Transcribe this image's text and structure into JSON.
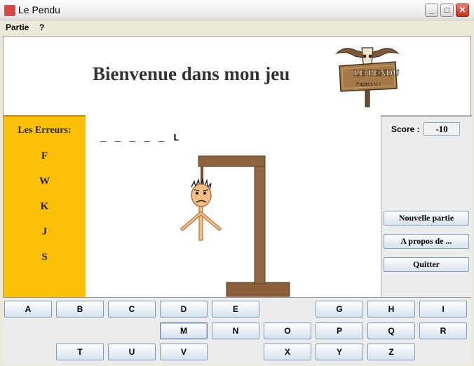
{
  "window": {
    "title": "Le Pendu"
  },
  "menu": {
    "items": [
      "Partie",
      "?"
    ]
  },
  "header": {
    "welcome": "Bienvenue dans mon jeu",
    "logo_text_main": "LE PENDU",
    "logo_text_sub": "Papiers U !"
  },
  "errors": {
    "title": "Les Erreurs:",
    "letters": [
      "F",
      "W",
      "K",
      "J",
      "S"
    ]
  },
  "word": {
    "display": "_ _ _ _ _ L"
  },
  "score": {
    "label": "Score :",
    "value": "-10"
  },
  "actions": {
    "new_game": "Nouvelle partie",
    "about": "A propos de ...",
    "quit": "Quitter"
  },
  "keyboard": {
    "row1": [
      "A",
      "B",
      "C",
      "D",
      "E",
      "",
      "G",
      "H",
      "I"
    ],
    "row2": [
      "M",
      "N",
      "O",
      "P",
      "Q",
      "R"
    ],
    "row3": [
      "T",
      "U",
      "V",
      "X",
      "Y",
      "Z"
    ]
  },
  "colors": {
    "errors_panel": "#fcc107",
    "gallows_wood": "#8a5f3a",
    "title_text": "#333333"
  }
}
